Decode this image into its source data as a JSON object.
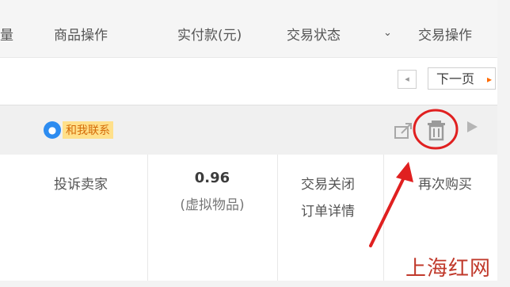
{
  "header": {
    "col_quantity_partial": "量",
    "col_goods_ops": "商品操作",
    "col_paid": "实付款(元)",
    "col_status": "交易状态",
    "status_dropdown_glyph": "⌄",
    "col_trade_ops": "交易操作"
  },
  "pager": {
    "prev_glyph": "◂",
    "next_label": "下一页",
    "next_glyph": "▸"
  },
  "order_header": {
    "contact_label": "和我联系",
    "contact_icon": "wangwang-icon",
    "actions": [
      "share-icon",
      "trash-icon",
      "more-icon"
    ]
  },
  "order_row": {
    "goods_op": "投诉卖家",
    "price": "0.96",
    "price_note": "(虚拟物品)",
    "status": "交易关闭",
    "detail_link": "订单详情",
    "buy_again": "再次购买"
  },
  "annotation": {
    "highlight_color": "#e02020",
    "target": "trash-icon"
  },
  "watermark": "上海红网"
}
